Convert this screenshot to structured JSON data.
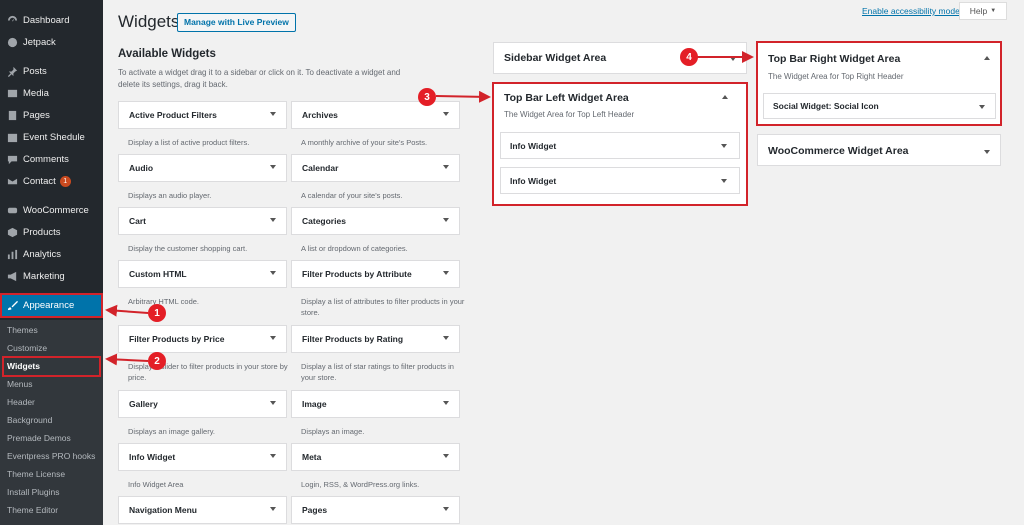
{
  "sidebar": {
    "items": [
      {
        "label": "Dashboard",
        "icon": "dashboard-icon"
      },
      {
        "label": "Jetpack",
        "icon": "jetpack-icon"
      },
      {
        "label": "Posts",
        "icon": "pin-icon"
      },
      {
        "label": "Media",
        "icon": "media-icon"
      },
      {
        "label": "Pages",
        "icon": "pages-icon"
      },
      {
        "label": "Event Shedule",
        "icon": "calendar-icon"
      },
      {
        "label": "Comments",
        "icon": "comment-icon"
      },
      {
        "label": "Contact",
        "icon": "mail-icon",
        "badge": "1"
      },
      {
        "label": "WooCommerce",
        "icon": "woocommerce-icon"
      },
      {
        "label": "Products",
        "icon": "box-icon"
      },
      {
        "label": "Analytics",
        "icon": "chart-icon"
      },
      {
        "label": "Marketing",
        "icon": "megaphone-icon"
      },
      {
        "label": "Appearance",
        "icon": "brush-icon"
      }
    ],
    "submenu": [
      "Themes",
      "Customize",
      "Widgets",
      "Menus",
      "Header",
      "Background",
      "Premade Demos",
      "Eventpress PRO hooks",
      "Theme License",
      "Install Plugins",
      "Theme Editor"
    ]
  },
  "header": {
    "title": "Widgets",
    "live_preview_label": "Manage with Live Preview",
    "accessibility_link": "Enable accessibility mode",
    "help_label": "Help"
  },
  "available": {
    "title": "Available Widgets",
    "description": "To activate a widget drag it to a sidebar or click on it. To deactivate a widget and delete its settings, drag it back.",
    "widgets": [
      {
        "name": "Active Product Filters",
        "desc": "Display a list of active product filters."
      },
      {
        "name": "Archives",
        "desc": "A monthly archive of your site's Posts."
      },
      {
        "name": "Audio",
        "desc": "Displays an audio player."
      },
      {
        "name": "Calendar",
        "desc": "A calendar of your site's posts."
      },
      {
        "name": "Cart",
        "desc": "Display the customer shopping cart."
      },
      {
        "name": "Categories",
        "desc": "A list or dropdown of categories."
      },
      {
        "name": "Custom HTML",
        "desc": "Arbitrary HTML code."
      },
      {
        "name": "Filter Products by Attribute",
        "desc": "Display a list of attributes to filter products in your store."
      },
      {
        "name": "Filter Products by Price",
        "desc": "Display a slider to filter products in your store by price."
      },
      {
        "name": "Filter Products by Rating",
        "desc": "Display a list of star ratings to filter products in your store."
      },
      {
        "name": "Gallery",
        "desc": "Displays an image gallery."
      },
      {
        "name": "Image",
        "desc": "Displays an image."
      },
      {
        "name": "Info Widget",
        "desc": "Info Widget Area"
      },
      {
        "name": "Meta",
        "desc": "Login, RSS, & WordPress.org links."
      },
      {
        "name": "Navigation Menu",
        "desc": ""
      },
      {
        "name": "Pages",
        "desc": ""
      }
    ]
  },
  "areas": {
    "sidebar_area": {
      "title": "Sidebar Widget Area"
    },
    "top_left": {
      "title": "Top Bar Left Widget Area",
      "desc": "The Widget Area for Top Left Header",
      "widgets": [
        "Info Widget",
        "Info Widget"
      ]
    },
    "top_right": {
      "title": "Top Bar Right Widget Area",
      "desc": "The Widget Area for Top Right Header",
      "widgets": [
        "Social Widget: Social Icon"
      ]
    },
    "woo": {
      "title": "WooCommerce Widget Area"
    }
  },
  "markers": [
    "1",
    "2",
    "3",
    "4"
  ],
  "colors": {
    "accent": "#0073aa",
    "annotation": "#d2232a",
    "sidebar_bg": "#23282d"
  }
}
